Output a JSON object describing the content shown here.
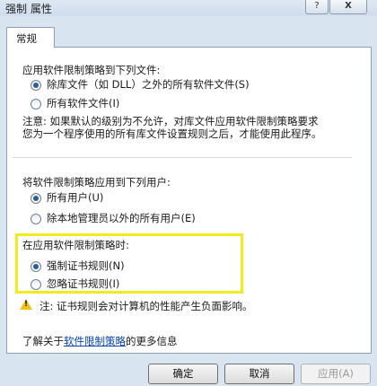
{
  "window": {
    "title": "强制 属性",
    "help_label": "?",
    "close_label": "X"
  },
  "tab": {
    "label": "常规"
  },
  "files_section": {
    "heading": "应用软件限制策略到下列文件:",
    "option1": "除库文件（如 DLL）之外的所有软件文件(S)",
    "option2": "所有软件文件(I)",
    "selected": "option1"
  },
  "note": {
    "line1": "注意: 如果默认的级别为不允许，对库文件应用软件限制策略要求",
    "line2": "您为一个程序使用的所有库文件设置规则之后，才能使用此程序。"
  },
  "users_section": {
    "heading": "将软件限制策略应用到下列用户:",
    "option1": "所有用户(U)",
    "option2": "除本地管理员以外的所有用户(E)",
    "selected": "option1"
  },
  "cert_section": {
    "heading": "在应用软件限制策略时:",
    "option1": "强制证书规则(N)",
    "option2": "忽略证书规则(I)",
    "selected": "option1"
  },
  "warning": {
    "text": "注: 证书规则会对计算机的性能产生负面影响。",
    "icon": "warning-icon"
  },
  "info": {
    "prefix": "了解关于",
    "link": "软件限制策略",
    "suffix": "的更多信息"
  },
  "buttons": {
    "ok": "确定",
    "cancel": "取消",
    "apply": "应用(A)"
  },
  "colors": {
    "highlight": "#f2ea1a",
    "link": "#0645ad",
    "warning": "#f1c21b"
  }
}
